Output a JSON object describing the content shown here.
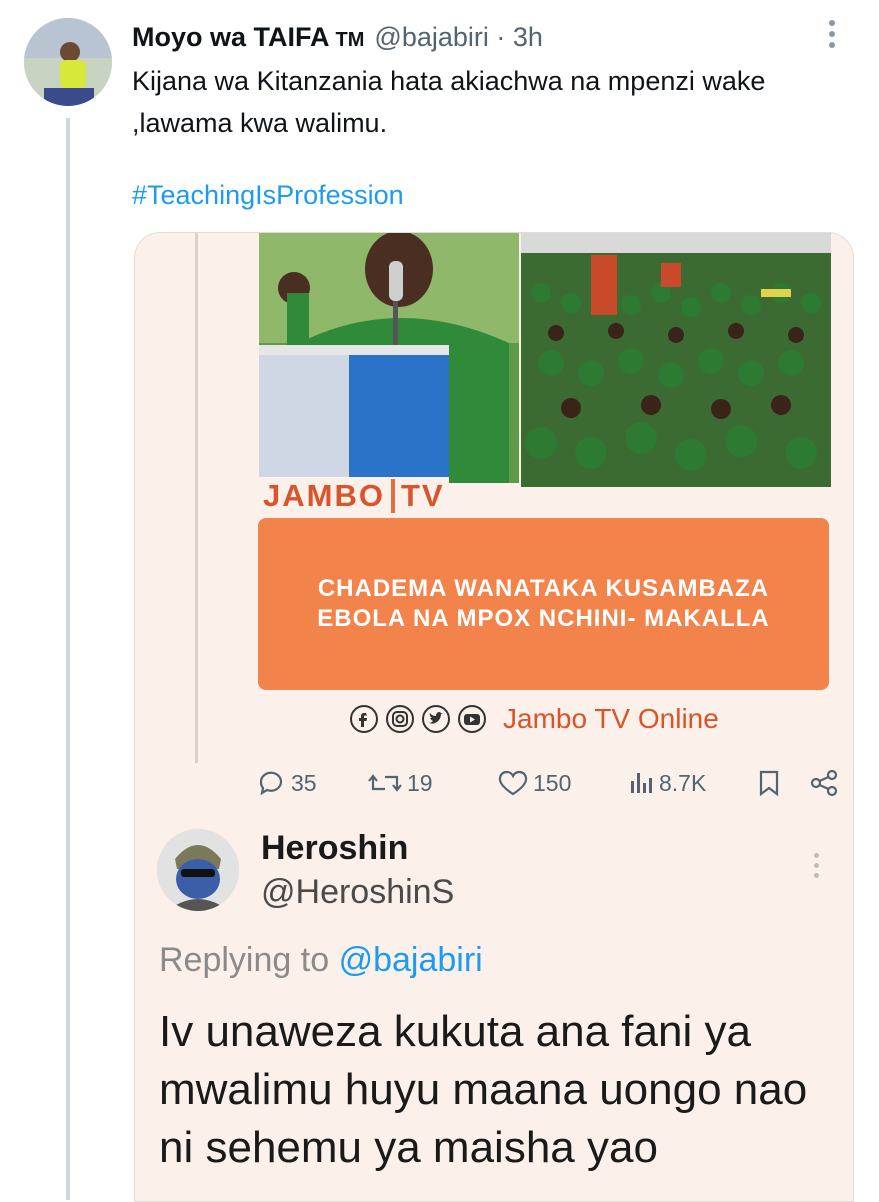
{
  "tweet": {
    "author_name": "Moyo wa TAIFA",
    "badge": "TM",
    "handle": "@bajabiri",
    "separator": "·",
    "time": "3h",
    "text": "Kijana wa Kitanzania hata akiachwa na mpenzi wake ,lawama kwa walimu.",
    "hashtag": "#TeachingIsProfession"
  },
  "image": {
    "brand_left": "JAMBO",
    "brand_right": "TV",
    "headline": "CHADEMA WANATAKA KUSAMBAZA EBOLA NA MPOX NCHINI- MAKALLA",
    "footer_text": "Jambo TV Online"
  },
  "metrics": {
    "replies": "35",
    "retweets": "19",
    "likes": "150",
    "views": "8.7K"
  },
  "reply": {
    "name": "Heroshin",
    "handle": "@HeroshinS",
    "replying_label": "Replying to",
    "replying_handle": "@bajabiri",
    "text": "Iv unaweza kukuta ana fani ya mwalimu huyu maana uongo nao ni sehemu ya maisha yao"
  },
  "colors": {
    "accent_link": "#1d9bf0",
    "banner_orange": "#f2834a",
    "brand_orange": "#d9542b",
    "card_bg": "#fbf1ea"
  },
  "icons": [
    "more-icon",
    "reply-icon",
    "retweet-icon",
    "like-icon",
    "views-icon",
    "bookmark-icon",
    "share-icon",
    "facebook-icon",
    "instagram-icon",
    "twitter-icon",
    "youtube-icon"
  ]
}
